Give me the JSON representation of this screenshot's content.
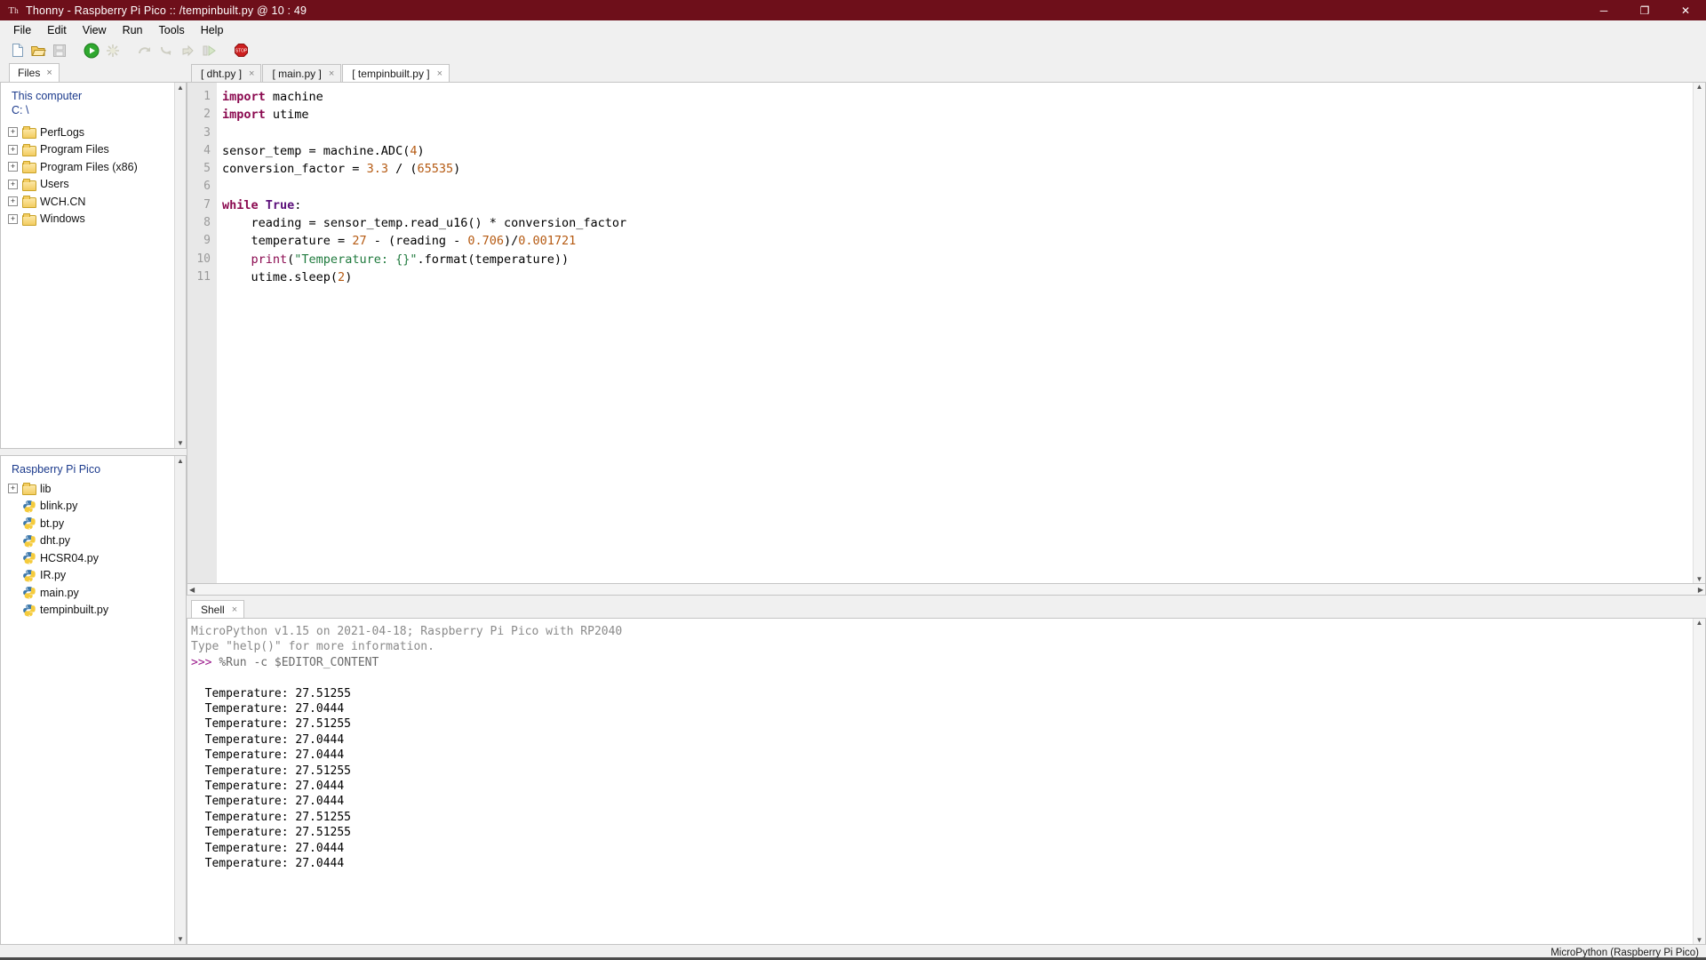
{
  "window": {
    "app_icon": "thonny-icon",
    "title": "Thonny  -  Raspberry Pi Pico :: /tempinbuilt.py  @  10 : 49",
    "minimize": "─",
    "maximize": "❐",
    "close": "✕",
    "titlebar_color": "#6e0f1a"
  },
  "menubar": {
    "items": [
      "File",
      "Edit",
      "View",
      "Run",
      "Tools",
      "Help"
    ]
  },
  "toolbar": {
    "items": [
      {
        "name": "new-file-icon",
        "tooltip": "New"
      },
      {
        "name": "open-file-icon",
        "tooltip": "Load"
      },
      {
        "name": "save-file-icon",
        "tooltip": "Save"
      },
      {
        "name": "run-icon",
        "tooltip": "Run current script"
      },
      {
        "name": "debug-icon",
        "tooltip": "Debug current script"
      },
      {
        "name": "step-over-icon",
        "tooltip": "Step over"
      },
      {
        "name": "step-into-icon",
        "tooltip": "Step into"
      },
      {
        "name": "step-out-icon",
        "tooltip": "Step out"
      },
      {
        "name": "resume-icon",
        "tooltip": "Resume"
      },
      {
        "name": "stop-icon",
        "tooltip": "Stop/Restart backend"
      }
    ],
    "stop_label": "STOP"
  },
  "files_panel": {
    "tab_label": "Files",
    "tab_close": "×",
    "header_line1": "This computer",
    "header_line2": "C: \\",
    "items": [
      {
        "label": "PerfLogs",
        "type": "folder",
        "expandable": true
      },
      {
        "label": "Program Files",
        "type": "folder",
        "expandable": true
      },
      {
        "label": "Program Files (x86)",
        "type": "folder",
        "expandable": true
      },
      {
        "label": "Users",
        "type": "folder",
        "expandable": true
      },
      {
        "label": "WCH.CN",
        "type": "folder",
        "expandable": true
      },
      {
        "label": "Windows",
        "type": "folder",
        "expandable": true
      }
    ]
  },
  "device_panel": {
    "header": "Raspberry Pi Pico",
    "items": [
      {
        "label": "lib",
        "type": "folder",
        "expandable": true
      },
      {
        "label": "blink.py",
        "type": "python",
        "expandable": false
      },
      {
        "label": "bt.py",
        "type": "python",
        "expandable": false
      },
      {
        "label": "dht.py",
        "type": "python",
        "expandable": false
      },
      {
        "label": "HCSR04.py",
        "type": "python",
        "expandable": false
      },
      {
        "label": "IR.py",
        "type": "python",
        "expandable": false
      },
      {
        "label": "main.py",
        "type": "python",
        "expandable": false
      },
      {
        "label": "tempinbuilt.py",
        "type": "python",
        "expandable": false
      }
    ]
  },
  "editor": {
    "tabs": [
      {
        "label": "[ dht.py ]",
        "close": "×",
        "active": false
      },
      {
        "label": "[ main.py ]",
        "close": "×",
        "active": false
      },
      {
        "label": "[ tempinbuilt.py ]",
        "close": "×",
        "active": true
      }
    ],
    "line_numbers": [
      "1",
      "2",
      "3",
      "4",
      "5",
      "6",
      "7",
      "8",
      "9",
      "10",
      "11"
    ],
    "lines": [
      "import machine",
      "import utime",
      "",
      "sensor_temp = machine.ADC(4)",
      "conversion_factor = 3.3 / (65535)",
      "",
      "while True:",
      "    reading = sensor_temp.read_u16() * conversion_factor",
      "    temperature = 27 - (reading - 0.706)/0.001721",
      "    print(\"Temperature: {}\".format(temperature))",
      "    utime.sleep(2)"
    ]
  },
  "shell": {
    "tab_label": "Shell",
    "tab_close": "×",
    "banner_line1": "MicroPython v1.15 on 2021-04-18; Raspberry Pi Pico with RP2040",
    "banner_line2": "Type \"help()\" for more information.",
    "prompt": ">>>",
    "command": "%Run -c $EDITOR_CONTENT",
    "output": [
      "Temperature: 27.51255",
      "Temperature: 27.0444",
      "Temperature: 27.51255",
      "Temperature: 27.0444",
      "Temperature: 27.0444",
      "Temperature: 27.51255",
      "Temperature: 27.0444",
      "Temperature: 27.0444",
      "Temperature: 27.51255",
      "Temperature: 27.51255",
      "Temperature: 27.0444",
      "Temperature: 27.0444"
    ]
  },
  "statusbar": {
    "interpreter": "MicroPython (Raspberry Pi Pico)"
  },
  "colors": {
    "title_bg": "#6e0f1a",
    "keyword": "#8b0a50",
    "builtin": "#5b0f7a",
    "number": "#b55a12",
    "string": "#1f7a3d",
    "tree_header": "#1b3a8c"
  }
}
